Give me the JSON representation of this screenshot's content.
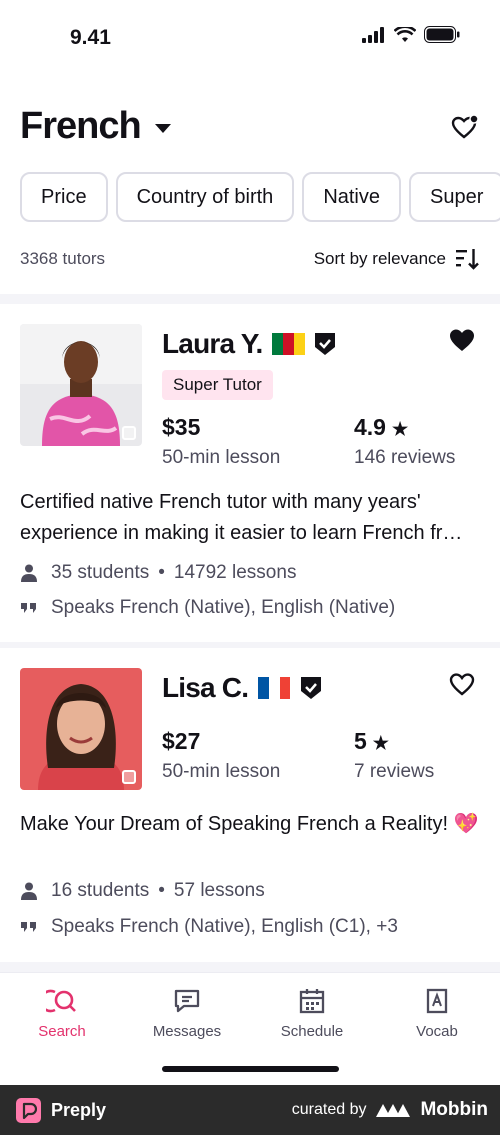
{
  "status_bar": {
    "time": "9.41"
  },
  "header": {
    "title": "French"
  },
  "filters": [
    "Price",
    "Country of birth",
    "Native",
    "Super"
  ],
  "results": {
    "count": "3368 tutors",
    "sort_label": "Sort by relevance"
  },
  "tutors": [
    {
      "name": "Laura Y.",
      "flag_colors": [
        "#007a3d",
        "#ce1126",
        "#fcd116"
      ],
      "favorited": true,
      "badge": "Super Tutor",
      "price": "$35",
      "price_sub": "50-min lesson",
      "rating": "4.9",
      "reviews": "146 reviews",
      "description": "Certified native French tutor with many years' experience in making it easier to learn French fr…",
      "students": "35 students",
      "lessons": "14792 lessons",
      "speaks": "Speaks French (Native), English (Native)"
    },
    {
      "name": "Lisa C.",
      "flag_colors": [
        "#0055a4",
        "#ffffff",
        "#ef4135"
      ],
      "favorited": false,
      "badge": "",
      "price": "$27",
      "price_sub": "50-min lesson",
      "rating": "5",
      "reviews": "7 reviews",
      "description": "Make Your Dream of Speaking French a Reality! 💖",
      "students": "16 students",
      "lessons": "57 lessons",
      "speaks": "Speaks French (Native), English (C1), +3"
    }
  ],
  "nav": [
    {
      "label": "Search",
      "icon": "search-icon",
      "active": true
    },
    {
      "label": "Messages",
      "icon": "messages-icon",
      "active": false
    },
    {
      "label": "Schedule",
      "icon": "calendar-icon",
      "active": false
    },
    {
      "label": "Vocab",
      "icon": "vocab-icon",
      "active": false
    }
  ],
  "footer": {
    "brand": "Preply",
    "curated_by": "curated by",
    "curator": "Mobbin"
  },
  "colors": {
    "accent": "#e3326d",
    "badge_bg": "#ffe4ef",
    "text": "#121117",
    "muted": "#4d4c5c"
  }
}
